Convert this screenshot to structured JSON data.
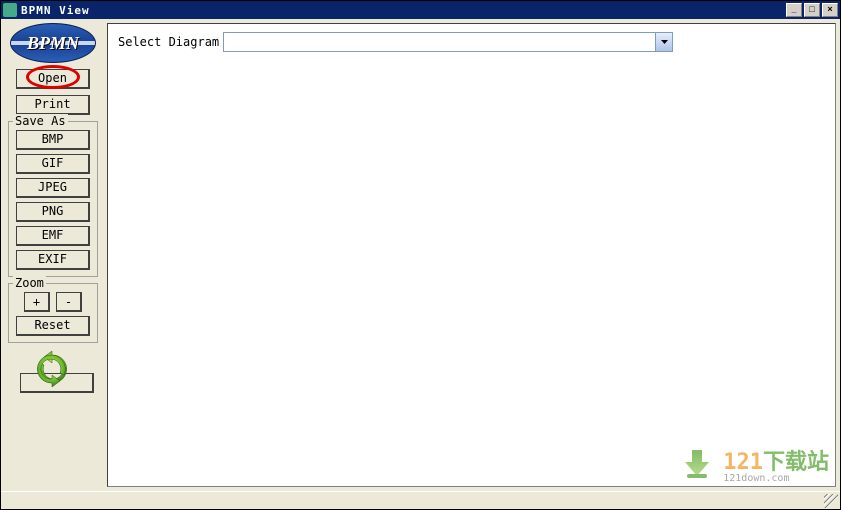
{
  "window": {
    "title": "BPMN View",
    "controls": {
      "min": "_",
      "max": "□",
      "close": "×"
    }
  },
  "logo": {
    "text": "BPMN"
  },
  "buttons": {
    "open": "Open",
    "print": "Print"
  },
  "saveas": {
    "legend": "Save As",
    "items": [
      "BMP",
      "GIF",
      "JPEG",
      "PNG",
      "EMF",
      "EXIF"
    ]
  },
  "zoom": {
    "legend": "Zoom",
    "plus": "+",
    "minus": "-",
    "reset": "Reset"
  },
  "main": {
    "select_label": "Select Diagram",
    "select_value": ""
  },
  "watermark": {
    "num": "121",
    "text": "下载站",
    "sub": "121down.com"
  }
}
